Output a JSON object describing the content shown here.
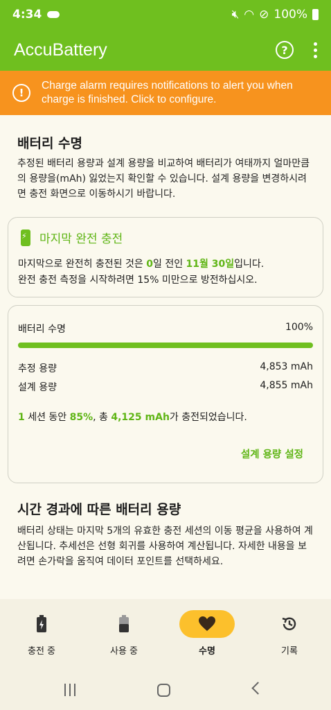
{
  "status": {
    "time": "4:34",
    "battery": "100%"
  },
  "app": {
    "title": "AccuBattery"
  },
  "alert": {
    "text": "Charge alarm requires notifications to alert you when charge is finished. Click to configure."
  },
  "health": {
    "title": "배터리 수명",
    "desc": "추정된 배터리 용량과 설계 용량을 비교하여 배터리가 여태까지 얼마만큼의 용량을(mAh) 잃었는지 확인할 수 있습니다. 설계 용량을 변경하시려면 충전 화면으로 이동하시기 바랍니다."
  },
  "last_full_charge": {
    "title": "마지막 완전 충전",
    "line1_pre": "마지막으로 완전히 충전된 것은 ",
    "days": "0",
    "line1_mid": "일 전인 ",
    "date": "11월 30일",
    "line1_post": "입니다.",
    "line2": "완전 충전 측정을 시작하려면 15% 미만으로 방전하십시오."
  },
  "capacity": {
    "label": "배터리 수명",
    "percent": "100%",
    "fill": 1.0,
    "estimated_label": "추정 용량",
    "estimated_value": "4,853 mAh",
    "design_label": "설계 용량",
    "design_value": "4,855 mAh",
    "sessions": "1",
    "sessions_text": " 세션 동안 ",
    "sessions_percent": "85%",
    "sessions_mid": ", 총 ",
    "sessions_mah": "4,125 mAh",
    "sessions_post": "가 충전되었습니다.",
    "set_design_button": "설계 용량 설정"
  },
  "over_time": {
    "title": "시간 경과에 따른 배터리 용량",
    "desc": "배터리 상태는 마지막 5개의 유효한 충전 세션의 이동 평균을 사용하여 계산됩니다. 추세선은 선형 회귀를 사용하여 계산됩니다. 자세한 내용을 보려면 손가락을 움직여 데이터 포인트를 선택하세요."
  },
  "nav": {
    "charging": "충전 중",
    "discharging": "사용 중",
    "health": "수명",
    "history": "기록"
  },
  "colors": {
    "accent": "#6fbf1f",
    "alert": "#f7931e",
    "active_pill": "#fcc02c"
  }
}
